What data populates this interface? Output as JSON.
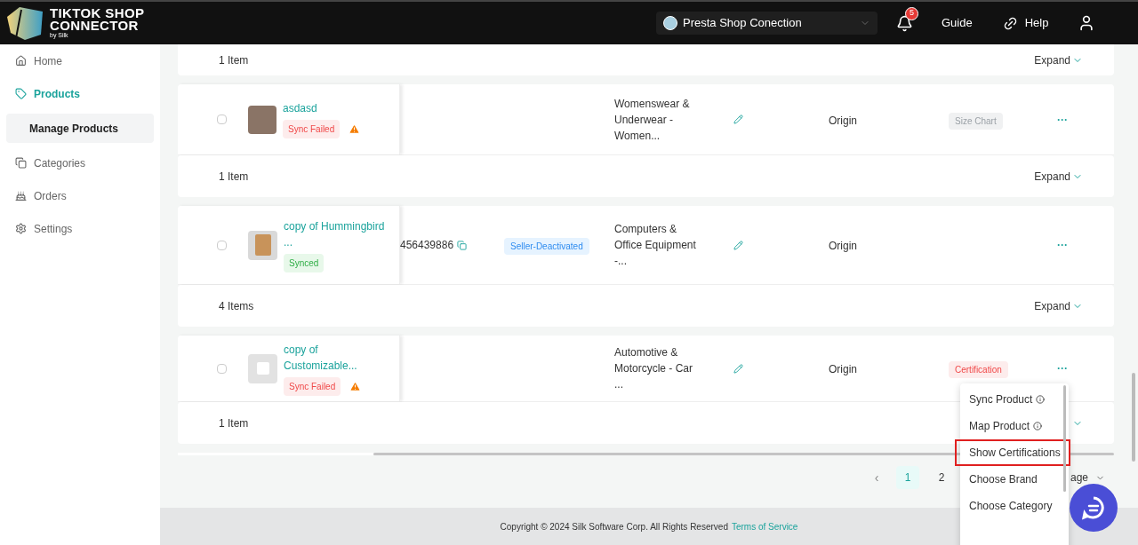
{
  "header": {
    "logo": {
      "line1": "TIKTOK SHOP",
      "line2": "CONNECTOR",
      "byline": "by Silk"
    },
    "store_select": {
      "value": "Presta Shop Conection"
    },
    "notifications": {
      "count": "5"
    },
    "links": [
      "Guide",
      "Help"
    ]
  },
  "sidebar": {
    "items": [
      {
        "label": "Home",
        "selected": false,
        "kind": "top"
      },
      {
        "label": "Products",
        "selected": true,
        "kind": "top"
      },
      {
        "label": "Manage Products",
        "selected": true,
        "kind": "sub"
      },
      {
        "label": "Categories",
        "selected": false,
        "kind": "top"
      },
      {
        "label": "Orders",
        "selected": false,
        "kind": "top"
      },
      {
        "label": "Settings",
        "selected": false,
        "kind": "top"
      }
    ]
  },
  "first_footer": {
    "count": "1 Item",
    "expand": "Expand"
  },
  "products": [
    {
      "name": "asdasd",
      "checked": false,
      "sync": {
        "label": "Sync Failed",
        "kind": "failed"
      },
      "warning": true,
      "category": "Womenswear & Underwear - Women...",
      "origin": "Origin",
      "tag": {
        "label": "Size Chart",
        "kind": "neutral"
      },
      "more": "···",
      "footer": {
        "count": "1 Item",
        "expand": "Expand"
      }
    },
    {
      "name": "copy of Hummingbird ...",
      "checked": false,
      "sync": {
        "label": "Synced",
        "kind": "ok"
      },
      "warning": false,
      "product_id": "456439886",
      "listing_status": "Seller-Deactivated",
      "category": "Computers & Office Equipment -...",
      "origin": "Origin",
      "more": "···",
      "footer": {
        "count": "4 Items",
        "expand": "Expand"
      }
    },
    {
      "name": "copy of Customizable...",
      "checked": false,
      "sync": {
        "label": "Sync Failed",
        "kind": "failed"
      },
      "warning": true,
      "category": "Automotive & Motorcycle - Car ...",
      "origin": "Origin",
      "tag": {
        "label": "Certification",
        "kind": "danger"
      },
      "more": "···",
      "footer": {
        "count": "1 Item"
      }
    }
  ],
  "pagination": {
    "prev": "‹",
    "pages": [
      {
        "label": "1",
        "selected": true
      },
      {
        "label": "2",
        "selected": false
      }
    ],
    "page_size": "age"
  },
  "menu": {
    "items": [
      {
        "label": "Sync Product",
        "info": true,
        "highlighted": false
      },
      {
        "label": "Map Product",
        "info": true,
        "highlighted": false
      },
      {
        "label": "Show Certifications",
        "info": false,
        "highlighted": true
      },
      {
        "label": "Choose Brand",
        "info": false,
        "highlighted": false
      },
      {
        "label": "Choose Category",
        "info": false,
        "highlighted": false
      }
    ]
  },
  "footer": {
    "copyright": "Copyright © 2024 Silk Software Corp. All Rights Reserved",
    "link": "Terms of Service"
  }
}
